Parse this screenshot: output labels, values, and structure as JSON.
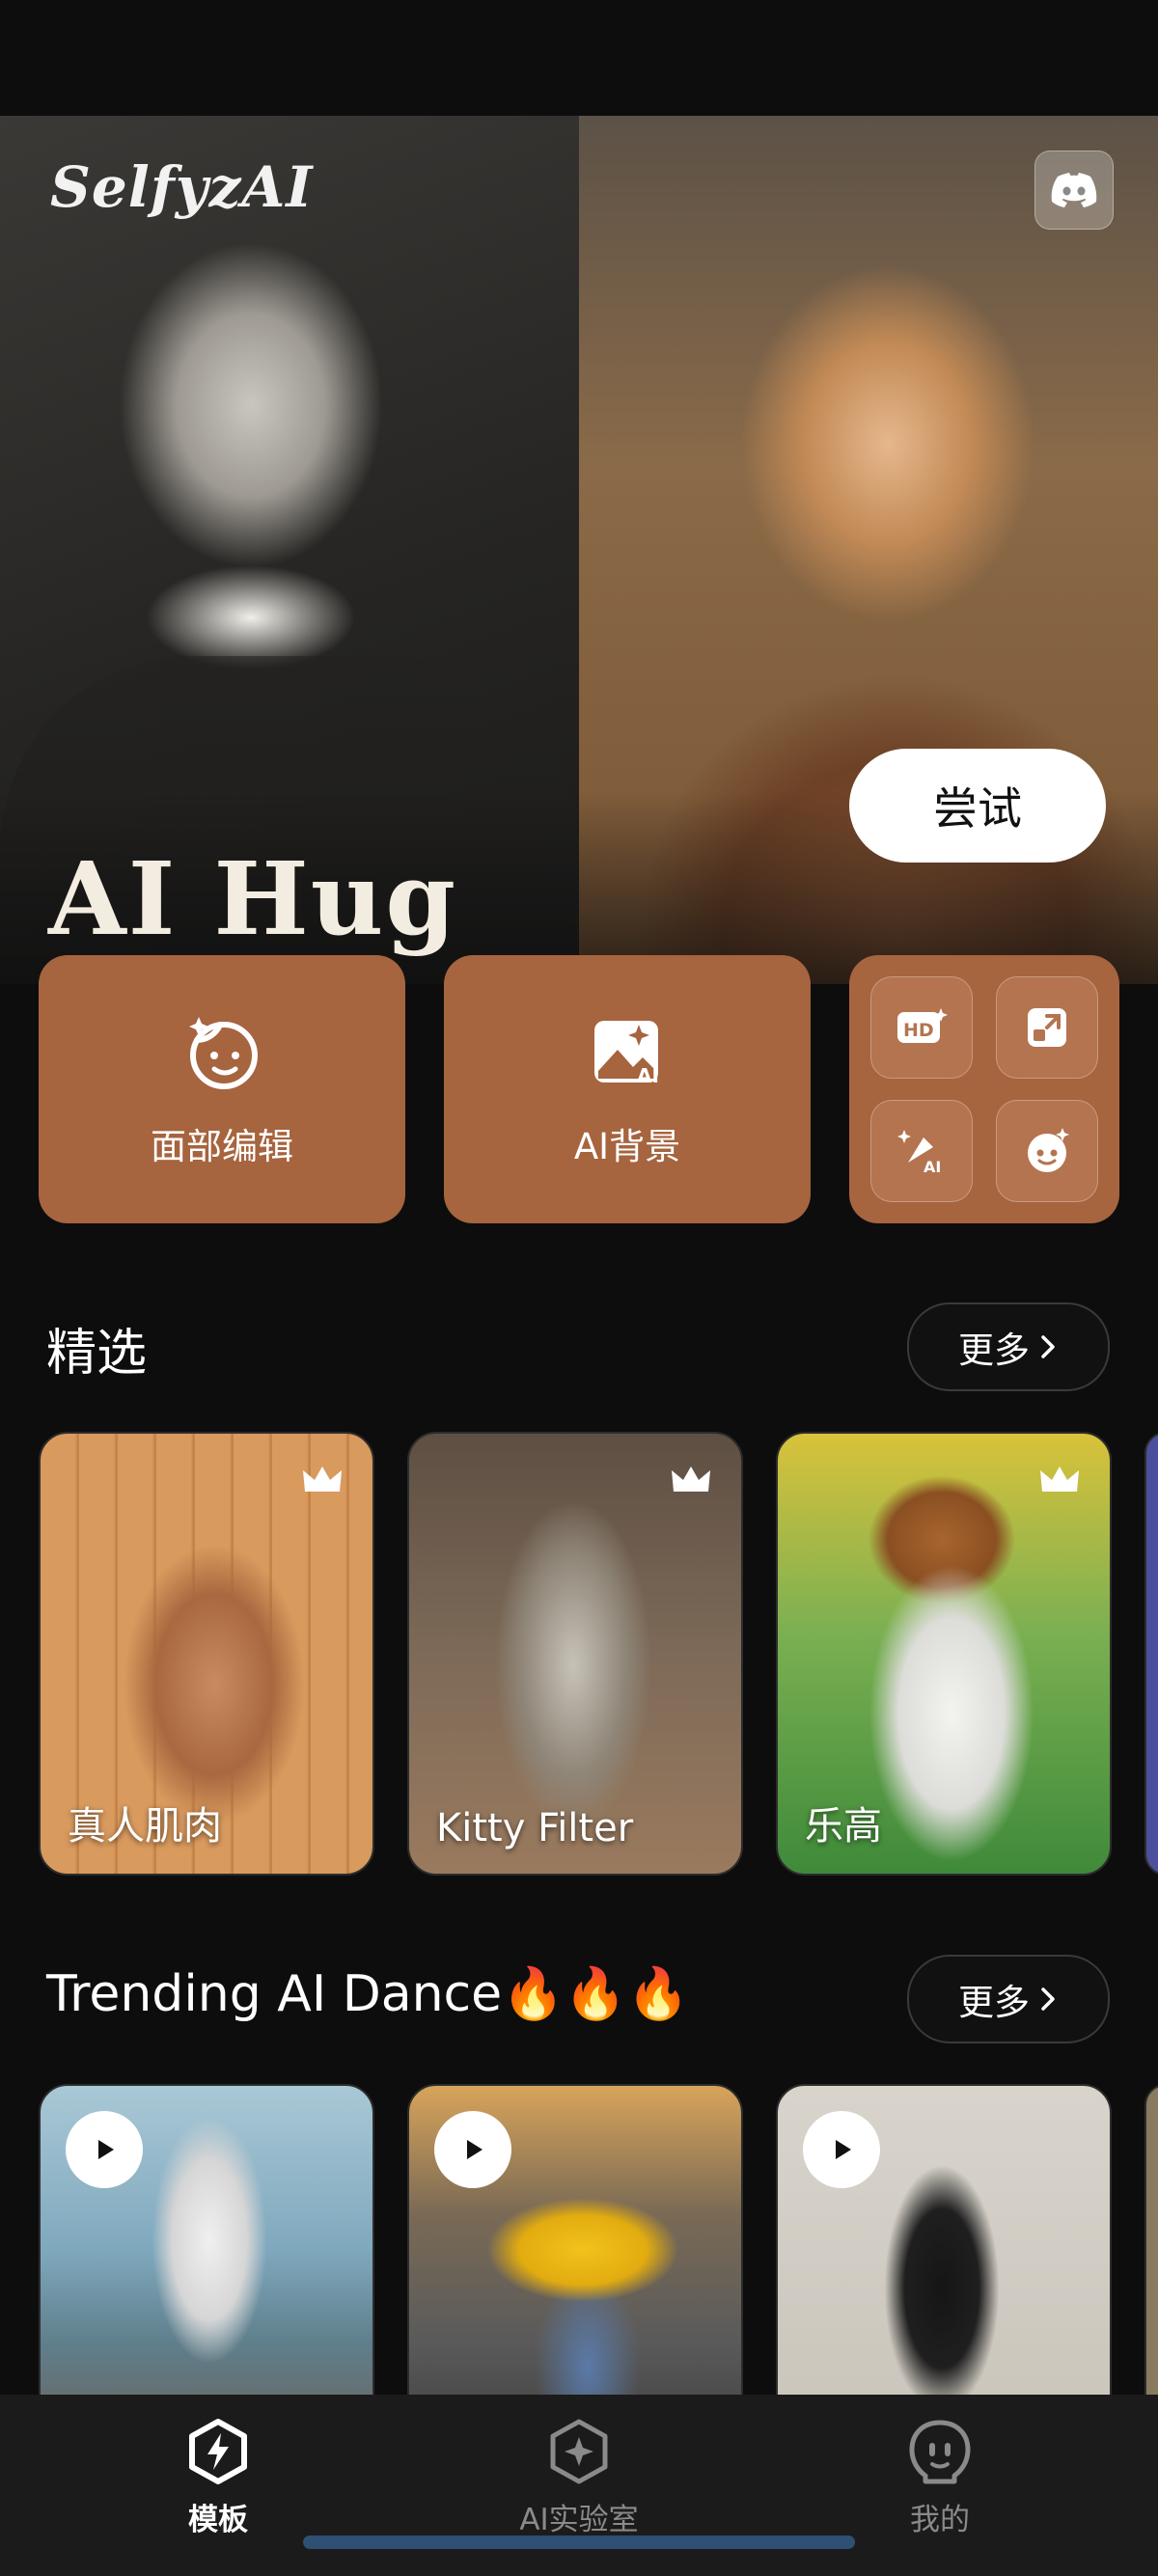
{
  "hero": {
    "logo": "SelfyzAI",
    "title": "AI Hug",
    "try_label": "尝试",
    "discord_icon": "discord-icon"
  },
  "features": {
    "face_edit_label": "面部编辑",
    "ai_background_label": "AI背景",
    "tools": [
      "hd-enhance-icon",
      "expand-image-icon",
      "ai-magic-icon",
      "face-swap-icon"
    ]
  },
  "featured": {
    "title": "精选",
    "more_label": "更多",
    "cards": [
      {
        "label": "真人肌肉",
        "premium": true
      },
      {
        "label": "Kitty Filter",
        "premium": true
      },
      {
        "label": "乐高",
        "premium": true
      }
    ]
  },
  "trending": {
    "title": "Trending AI Dance🔥🔥🔥",
    "more_label": "更多",
    "cards": [
      {
        "has_play": true
      },
      {
        "has_play": true
      },
      {
        "has_play": true
      }
    ]
  },
  "nav": {
    "items": [
      {
        "label": "模板",
        "icon": "template-icon",
        "active": true
      },
      {
        "label": "AI实验室",
        "icon": "ai-lab-icon",
        "active": false
      },
      {
        "label": "我的",
        "icon": "profile-icon",
        "active": false
      }
    ]
  },
  "colors": {
    "accent_tile": "#a6643f",
    "background": "#0d0d0d",
    "nav_background": "#1b1b1b"
  }
}
